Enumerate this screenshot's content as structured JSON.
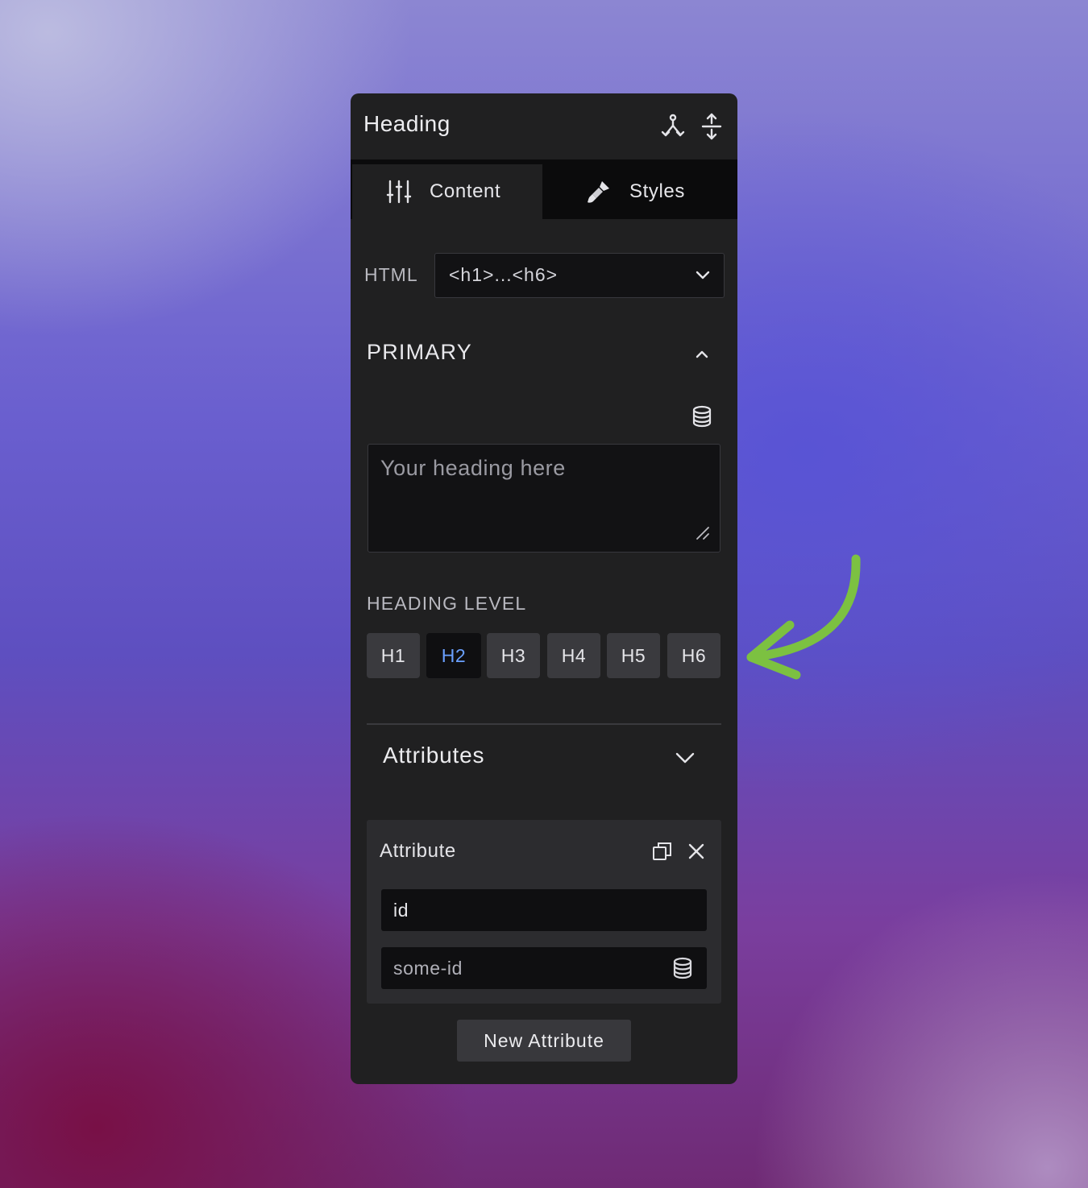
{
  "panel": {
    "title": "Heading",
    "header_icons": [
      "tree-branch-icon",
      "expand-vertical-icon"
    ]
  },
  "tabs": [
    {
      "label": "Content",
      "icon": "sliders-icon",
      "active": true
    },
    {
      "label": "Styles",
      "icon": "paintbrush-icon",
      "active": false
    }
  ],
  "html_tag": {
    "label": "HTML",
    "value": "<h1>...<h6>"
  },
  "primary": {
    "title": "PRIMARY",
    "expanded": true,
    "heading_placeholder": "Your heading here",
    "heading_level_label": "HEADING LEVEL",
    "levels": [
      "H1",
      "H2",
      "H3",
      "H4",
      "H5",
      "H6"
    ],
    "selected_level": "H2"
  },
  "attributes": {
    "title": "Attributes",
    "card_title": "Attribute",
    "name_value": "id",
    "value_value": "some-id",
    "new_button_label": "New Attribute"
  },
  "colors": {
    "panel_bg": "#202021",
    "active_level_text": "#6aa0ff",
    "annotation_arrow": "#7cc141"
  }
}
